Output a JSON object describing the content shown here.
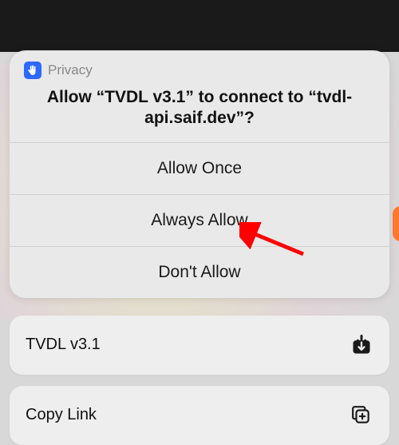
{
  "dialog": {
    "privacy_label": "Privacy",
    "message": "Allow “TVDL v3.1” to connect to “tvdl-api.saif.dev”?",
    "buttons": {
      "allow_once": "Allow Once",
      "always_allow": "Always Allow",
      "dont_allow": "Don't Allow"
    }
  },
  "share_actions": {
    "tvdl": "TVDL v3.1",
    "copy_link": "Copy Link"
  }
}
